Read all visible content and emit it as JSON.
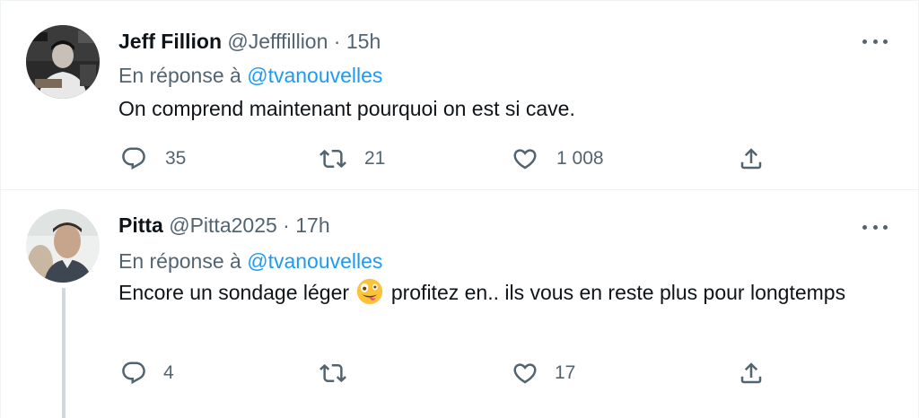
{
  "tweets": [
    {
      "name": "Jeff Fillion",
      "handle": "@Jefffillion",
      "separator": "·",
      "time": "15h",
      "reply_prefix": "En réponse à",
      "reply_mention": "@tvanouvelles",
      "text": "On comprend maintenant pourquoi on est si cave.",
      "replies": "35",
      "retweets": "21",
      "likes": "1 008",
      "icons": [
        "reply-icon",
        "retweet-icon",
        "heart-icon",
        "share-icon",
        "more-icon"
      ]
    },
    {
      "name": "Pitta",
      "handle": "@Pitta2025",
      "separator": "·",
      "time": "17h",
      "reply_prefix": "En réponse à",
      "reply_mention": "@tvanouvelles",
      "text_before": "Encore un sondage léger",
      "text_after": "profitez en.. ils vous en reste plus pour longtemps",
      "emoji": "zany-face-emoji",
      "replies": "4",
      "retweets": "",
      "likes": "17",
      "icons": [
        "reply-icon",
        "retweet-icon",
        "heart-icon",
        "share-icon",
        "more-icon"
      ]
    }
  ],
  "colors": {
    "text": "#0f1419",
    "muted": "#536471",
    "link": "#1d9bf0",
    "divider": "#eff3f4",
    "thread_line": "#cfd9de"
  }
}
